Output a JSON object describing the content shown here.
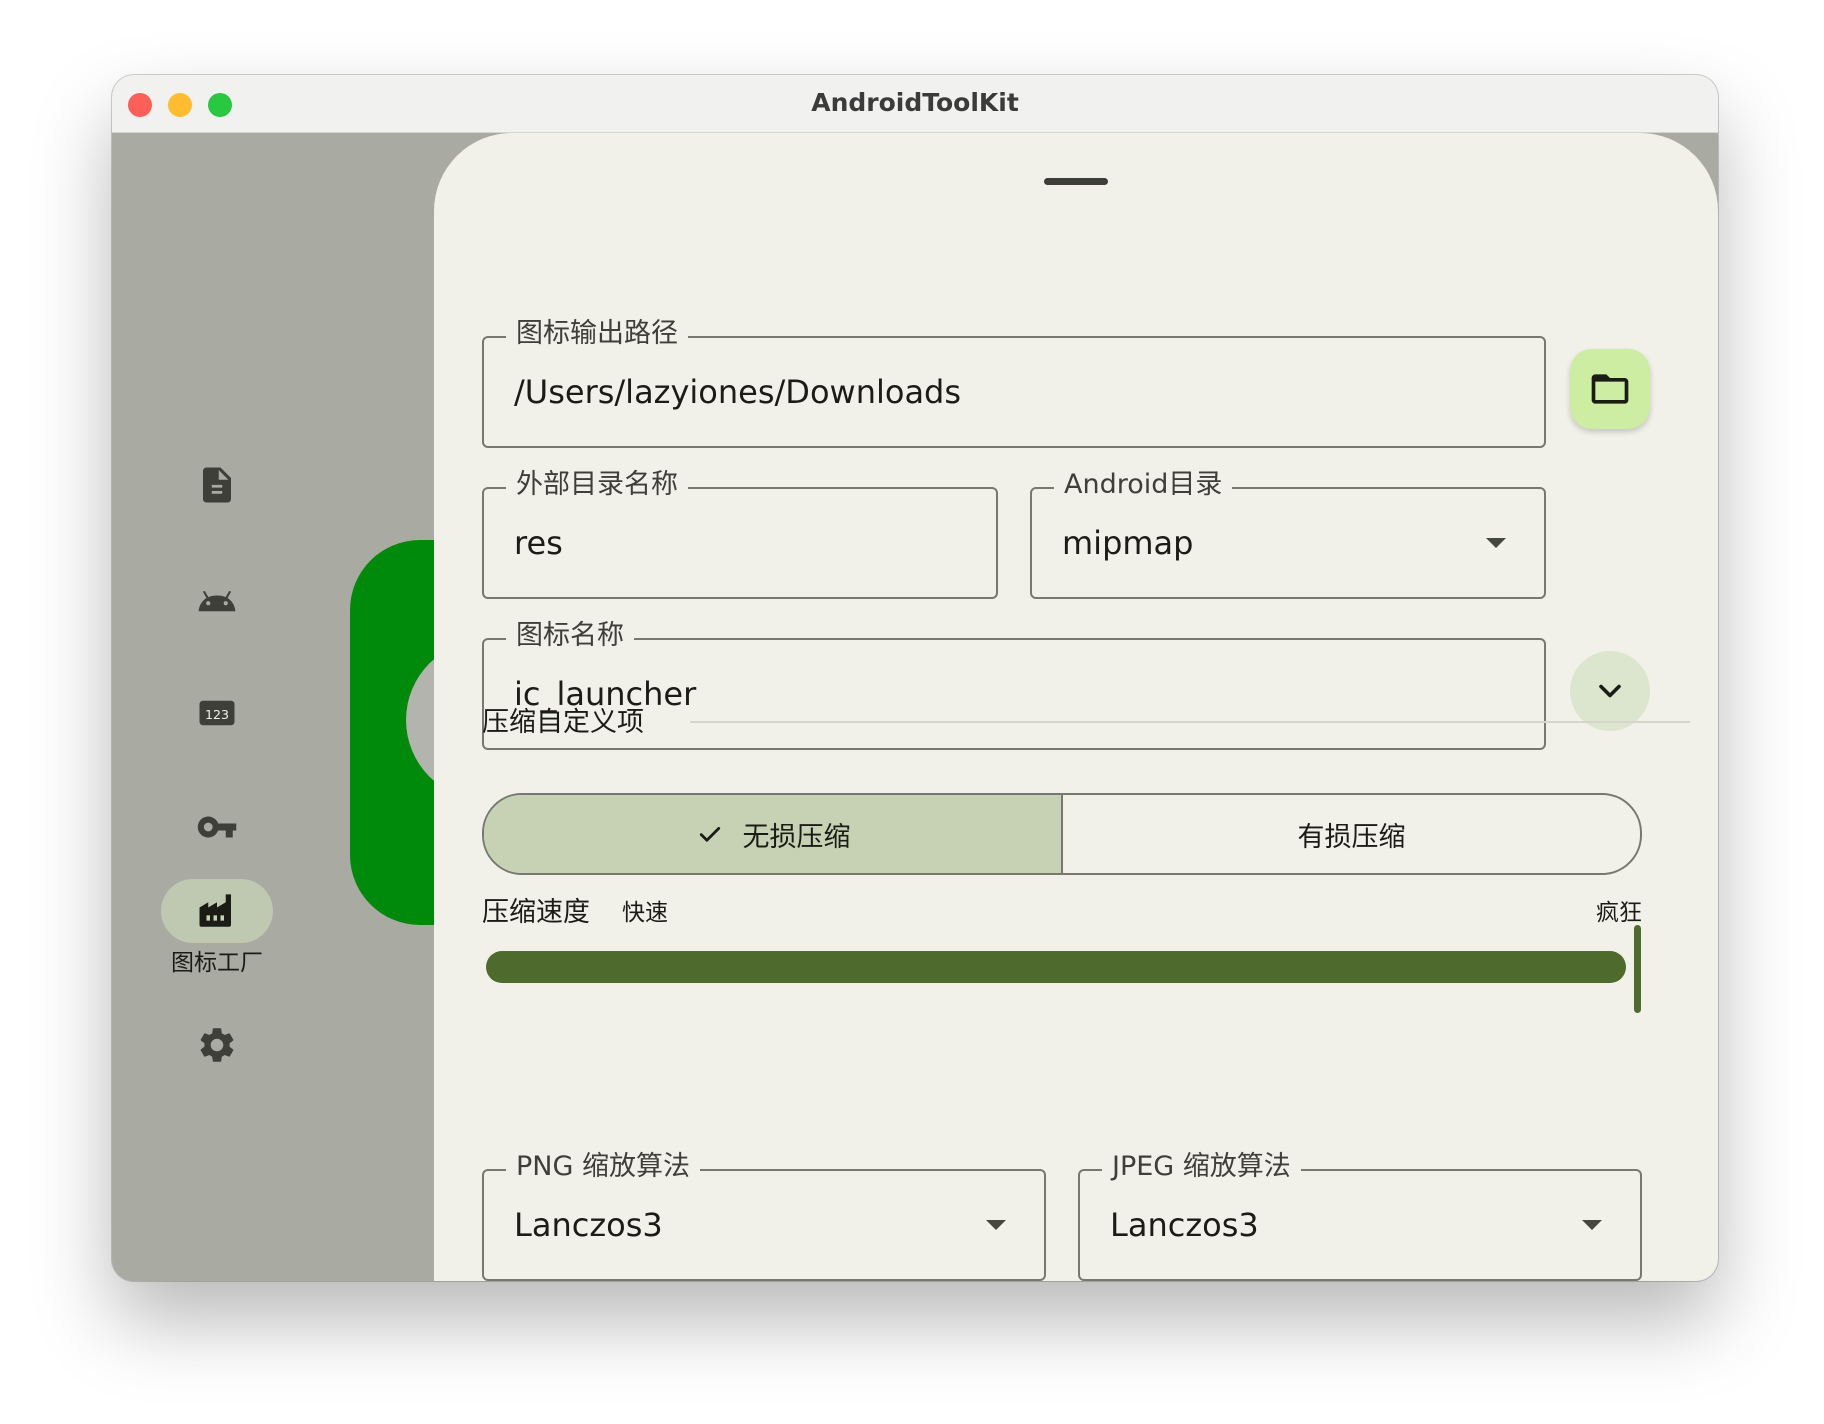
{
  "window": {
    "title": "AndroidToolKit"
  },
  "sidebar": {
    "items": [
      {
        "icon": "file-document-icon"
      },
      {
        "icon": "android-icon"
      },
      {
        "icon": "numeric-123-icon"
      },
      {
        "icon": "key-icon"
      },
      {
        "icon": "factory-icon",
        "label": "图标工厂",
        "active": true
      },
      {
        "icon": "gear-icon"
      }
    ]
  },
  "form": {
    "output_path": {
      "label": "图标输出路径",
      "value": "/Users/lazyiones/Downloads"
    },
    "external_dir": {
      "label": "外部目录名称",
      "value": "res"
    },
    "android_dir": {
      "label": "Android目录",
      "value": "mipmap"
    },
    "icon_name": {
      "label": "图标名称",
      "value": "ic_launcher"
    },
    "section_title": "压缩自定义项",
    "compression_modes": [
      {
        "label": "无损压缩",
        "selected": true
      },
      {
        "label": "有损压缩",
        "selected": false
      }
    ],
    "speed": {
      "label": "压缩速度",
      "min_label": "快速",
      "max_label": "疯狂",
      "fraction": 1.0
    },
    "png_algorithm": {
      "label": "PNG 缩放算法",
      "value": "Lanczos3"
    },
    "jpeg_algorithm": {
      "label": "JPEG 缩放算法",
      "value": "Lanczos3"
    }
  },
  "colors": {
    "accent": "#4e6a2d",
    "selected_segment": "#c7d2b5",
    "folder_button": "#cdeda3",
    "backdrop_green": "#008a0c"
  }
}
